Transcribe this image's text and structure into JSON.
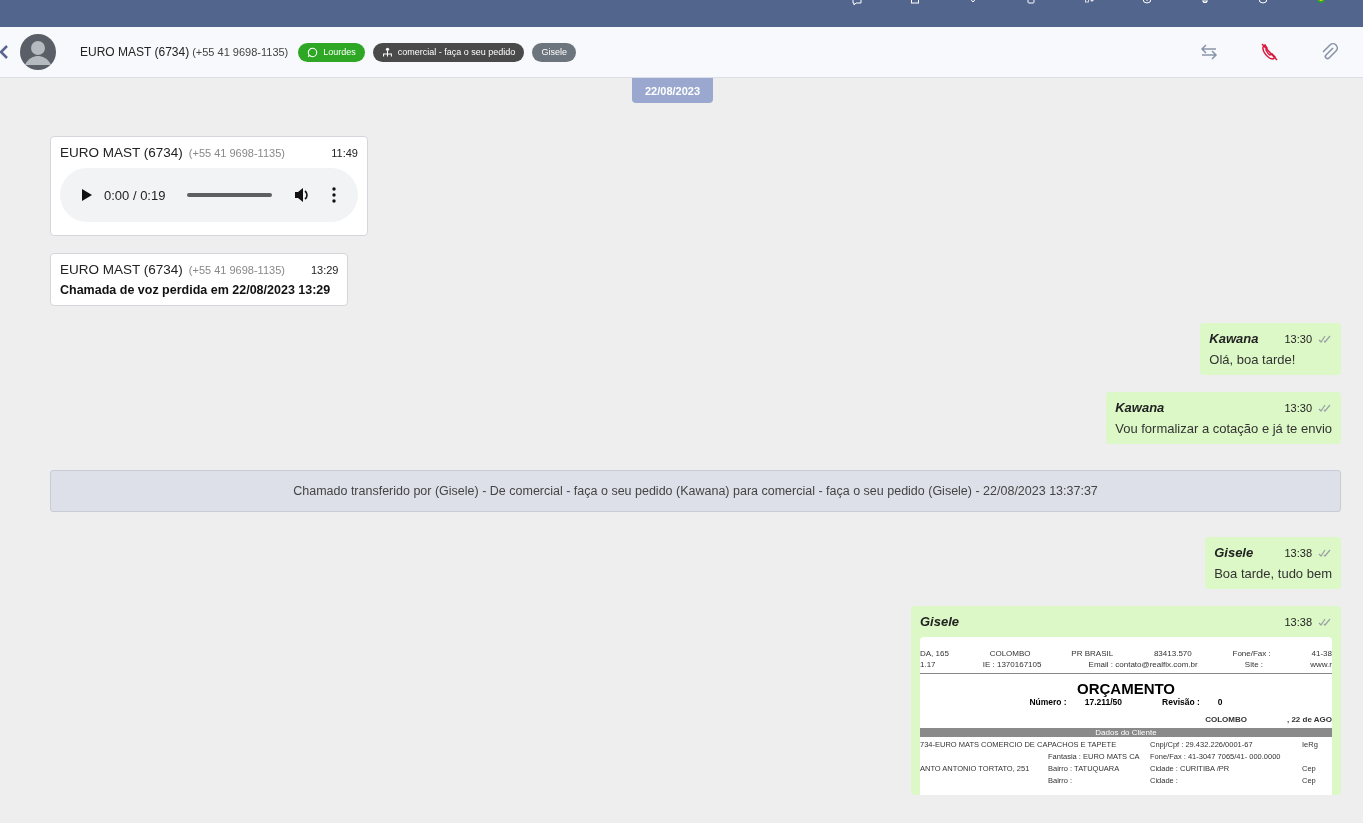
{
  "header": {
    "contact_name": "EURO MAST (6734)",
    "contact_phone": "(+55 41 9698-1135)",
    "tags": [
      {
        "kind": "whatsapp",
        "label": "Lourdes",
        "color": "#2ea824"
      },
      {
        "kind": "department",
        "label": "comercial - faça o seu pedido",
        "color": "#4a4a4a"
      },
      {
        "kind": "plain",
        "label": "Gisele",
        "color": "#6c757d"
      }
    ]
  },
  "date_badge": "22/08/2023",
  "messages": [
    {
      "kind": "audio",
      "outgoing": false,
      "sender": "EURO MAST (6734)",
      "phone": "(+55 41 9698-1135)",
      "time": "11:49",
      "audio_time": "0:00 / 0:19"
    },
    {
      "kind": "text",
      "outgoing": false,
      "sender": "EURO MAST (6734)",
      "phone": "(+55 41 9698-1135)",
      "time": "13:29",
      "text": "Chamada de voz perdida em 22/08/2023 13:29",
      "bold": true
    },
    {
      "kind": "text",
      "outgoing": true,
      "sender": "Kawana",
      "time": "13:30",
      "text": "Olá, boa tarde!",
      "bold": false
    },
    {
      "kind": "text",
      "outgoing": true,
      "sender": "Kawana",
      "time": "13:30",
      "text": "Vou formalizar a cotação e já te envio",
      "bold": false
    },
    {
      "kind": "system",
      "text": "Chamado transferido por (Gisele) - De comercial - faça o seu pedido (Kawana) para comercial - faça o seu pedido (Gisele) - 22/08/2023 13:37:37"
    },
    {
      "kind": "text",
      "outgoing": true,
      "sender": "Gisele",
      "time": "13:38",
      "text": "Boa tarde, tudo bem",
      "bold": false
    },
    {
      "kind": "document",
      "outgoing": true,
      "sender": "Gisele",
      "time": "13:38",
      "document": {
        "header_lines": [
          [
            "DA, 165",
            "COLOMBO",
            "PR BRASIL",
            "83413.570",
            "Fone/Fax :",
            "41-38"
          ],
          [
            "1.17",
            "IE : 1370167105",
            "Email : contato@realfix.com.br",
            "Site :",
            "www.r"
          ]
        ],
        "title": "ORÇAMENTO",
        "number_label": "Número :",
        "number": "17.211/50",
        "revision_label": "Revisão :",
        "revision": "0",
        "place": "COLOMBO",
        "date": ", 22 de AGO",
        "section": "Dados do Cliente",
        "rows": [
          [
            "734-EURO MATS COMERCIO DE CAPACHOS E TAPETE",
            "",
            "Cnpj/Cpf : 29.432.226/0001-67",
            "IeRg"
          ],
          [
            "",
            "Fantasia : EURO MATS CA",
            "Fone/Fax : 41-3047 7065/41- 000.0000",
            ""
          ],
          [
            "ANTO ANTONIO TORTATO, 251",
            "Bairro : TATUQUARA",
            "Cidade : CURITIBA /PR",
            "Cep"
          ],
          [
            "",
            "Bairro :",
            "Cidade :",
            "Cep"
          ]
        ]
      }
    }
  ]
}
